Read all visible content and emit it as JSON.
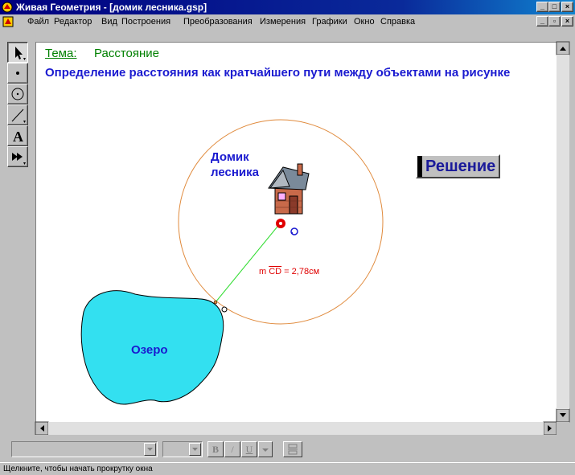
{
  "window": {
    "title": "Живая Геометрия - [домик лесника.gsp]",
    "controls": [
      "_",
      "□",
      "×"
    ],
    "doc_controls": [
      "_",
      "▫",
      "×"
    ]
  },
  "menu": {
    "items": [
      "Файл",
      "Редактор",
      "Вид",
      "Построения",
      "Преобразования",
      "Измерения",
      "Графики",
      "Окно",
      "Справка"
    ]
  },
  "toolbox": {
    "tools": [
      {
        "name": "select-arrow-tool",
        "icon": "arrow-icon",
        "active": true
      },
      {
        "name": "point-tool",
        "icon": "point-icon",
        "active": false
      },
      {
        "name": "compass-tool",
        "icon": "circle-icon",
        "active": false
      },
      {
        "name": "straightedge-tool",
        "icon": "segment-icon",
        "active": false
      },
      {
        "name": "text-tool",
        "icon": "letter-a-icon",
        "label": "A",
        "active": false
      },
      {
        "name": "custom-tool",
        "icon": "double-arrow-icon",
        "active": false
      }
    ]
  },
  "canvas": {
    "topic_label": "Тема:",
    "topic_value": "Расстояние",
    "subtitle": "Определение расстояния как кратчайшего пути между объектами на рисунке",
    "house_label_line1": "Домик",
    "house_label_line2": "лесника",
    "lake_label": "Озеро",
    "measure_prefix": "m ",
    "measure_segment": "CD",
    "measure_value": " = 2,78см",
    "solution_button": "Решение",
    "colors": {
      "circle": "#e08a3c",
      "segment": "#33dd33",
      "lake_fill": "#33e0f0",
      "label_blue": "#1a1ad0",
      "topic_green": "#008000",
      "measure_red": "#e00000"
    }
  },
  "textbar": {
    "bold": "B",
    "italic": "/",
    "underline": "U"
  },
  "status": {
    "text": "Щелкните, чтобы начать прокрутку окна"
  }
}
